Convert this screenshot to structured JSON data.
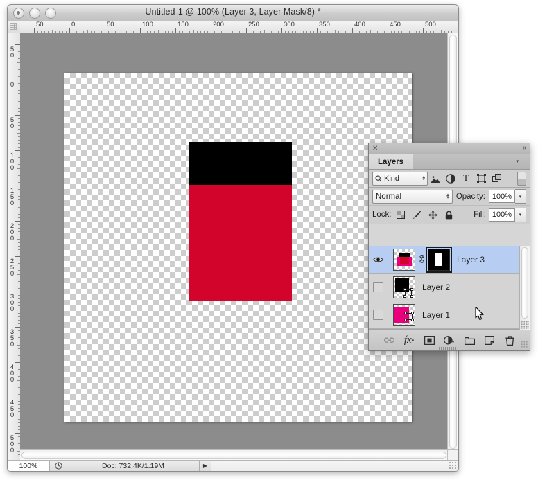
{
  "window": {
    "title": "Untitled-1 @ 100% (Layer 3, Layer Mask/8) *",
    "buttons": [
      "close",
      "minimize",
      "zoom"
    ]
  },
  "rulers": {
    "horizontal_labels": [
      "50",
      "0",
      "50",
      "100",
      "150",
      "200",
      "250",
      "300",
      "350",
      "400",
      "450",
      "500"
    ],
    "vertical_labels": [
      "50",
      "0",
      "50",
      "100",
      "150",
      "200",
      "250",
      "300",
      "350",
      "400",
      "450",
      "500"
    ],
    "unit": "px",
    "tick_spacing_px": 51
  },
  "canvas": {
    "background": "transparent-checkerboard",
    "artwork": [
      {
        "name": "black-band",
        "color": "#000000"
      },
      {
        "name": "red-fill",
        "color": "#D3042C"
      }
    ]
  },
  "statusbar": {
    "zoom": "100%",
    "doc_info": "Doc: 732.4K/1.19M",
    "arrow": "▶"
  },
  "layers_panel": {
    "close_glyph": "✕",
    "collapse_glyph": "«",
    "tab_label": "Layers",
    "filter": {
      "search_icon": "search-icon",
      "kind_label": "Kind",
      "stepper_up": "▴",
      "stepper_down": "▾",
      "icons": [
        "pixel-layer-filter-icon",
        "adjustment-layer-filter-icon",
        "type-layer-filter-icon",
        "shape-layer-filter-icon",
        "smart-object-filter-icon"
      ]
    },
    "blend": {
      "mode": "Normal",
      "opacity_label": "Opacity:",
      "opacity_value": "100%",
      "arrow": "▾"
    },
    "lock": {
      "label": "Lock:",
      "fill_label": "Fill:",
      "fill_value": "100%",
      "icons": [
        "lock-transparency-icon",
        "lock-image-icon",
        "lock-position-icon",
        "lock-all-icon"
      ],
      "arrow": "▾"
    },
    "rows": [
      {
        "name": "Layer 3",
        "visible": true,
        "selected": true,
        "has_mask": true,
        "linked": true,
        "link_glyph": "⚭",
        "thumb_colors": [
          "#000000",
          "#E8007D",
          "#D3042C"
        ]
      },
      {
        "name": "Layer 2",
        "visible": false,
        "selected": false,
        "has_mask": false,
        "linked": false,
        "thumb_colors": [
          "#000000"
        ]
      },
      {
        "name": "Layer 1",
        "visible": false,
        "selected": false,
        "has_mask": false,
        "linked": false,
        "thumb_colors": [
          "#E8007D"
        ]
      }
    ],
    "footer_buttons": [
      "link-layers-icon",
      "layer-style-icon",
      "add-mask-icon",
      "adjustment-layer-icon",
      "new-group-icon",
      "new-layer-icon",
      "delete-layer-icon"
    ]
  },
  "colors": {
    "selection_blue": "#B8CDF2",
    "canvas_gray": "#8C8C8C",
    "panel_gray": "#D6D6D6",
    "red": "#D3042C",
    "magenta": "#E8007D"
  }
}
